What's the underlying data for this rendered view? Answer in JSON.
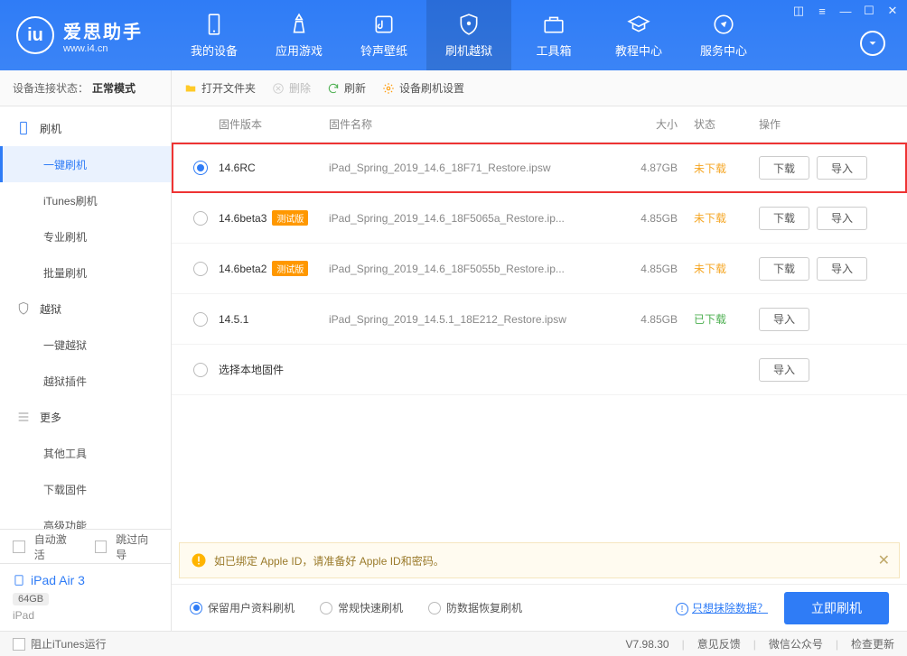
{
  "app": {
    "title": "爱思助手",
    "subtitle": "www.i4.cn"
  },
  "nav": {
    "items": [
      {
        "label": "我的设备"
      },
      {
        "label": "应用游戏"
      },
      {
        "label": "铃声壁纸"
      },
      {
        "label": "刷机越狱"
      },
      {
        "label": "工具箱"
      },
      {
        "label": "教程中心"
      },
      {
        "label": "服务中心"
      }
    ]
  },
  "sidebar": {
    "conn_label": "设备连接状态：",
    "conn_value": "正常模式",
    "groups": [
      {
        "label": "刷机",
        "items": [
          "一键刷机",
          "iTunes刷机",
          "专业刷机",
          "批量刷机"
        ],
        "active": 0
      },
      {
        "label": "越狱",
        "items": [
          "一键越狱",
          "越狱插件"
        ]
      },
      {
        "label": "更多",
        "items": [
          "其他工具",
          "下载固件",
          "高级功能"
        ]
      }
    ],
    "auto_activate": "自动激活",
    "skip_guide": "跳过向导",
    "device": {
      "name": "iPad Air 3",
      "storage": "64GB",
      "type": "iPad"
    }
  },
  "toolbar": {
    "open_folder": "打开文件夹",
    "delete": "删除",
    "refresh": "刷新",
    "settings": "设备刷机设置"
  },
  "table": {
    "headers": {
      "version": "固件版本",
      "name": "固件名称",
      "size": "大小",
      "status": "状态",
      "actions": "操作"
    }
  },
  "firmware": [
    {
      "version": "14.6RC",
      "beta": false,
      "name": "iPad_Spring_2019_14.6_18F71_Restore.ipsw",
      "size": "4.87GB",
      "status": "未下载",
      "status_type": "undownloaded",
      "selected": true,
      "highlighted": true,
      "can_download": true
    },
    {
      "version": "14.6beta3",
      "beta": true,
      "name": "iPad_Spring_2019_14.6_18F5065a_Restore.ip...",
      "size": "4.85GB",
      "status": "未下载",
      "status_type": "undownloaded",
      "selected": false,
      "highlighted": false,
      "can_download": true
    },
    {
      "version": "14.6beta2",
      "beta": true,
      "name": "iPad_Spring_2019_14.6_18F5055b_Restore.ip...",
      "size": "4.85GB",
      "status": "未下载",
      "status_type": "undownloaded",
      "selected": false,
      "highlighted": false,
      "can_download": true
    },
    {
      "version": "14.5.1",
      "beta": false,
      "name": "iPad_Spring_2019_14.5.1_18E212_Restore.ipsw",
      "size": "4.85GB",
      "status": "已下载",
      "status_type": "downloaded",
      "selected": false,
      "highlighted": false,
      "can_download": false
    }
  ],
  "local_firmware_label": "选择本地固件",
  "beta_badge": "测试版",
  "btn": {
    "download": "下载",
    "import": "导入"
  },
  "alert": "如已绑定 Apple ID，请准备好 Apple ID和密码。",
  "options": {
    "opt1": "保留用户资料刷机",
    "opt2": "常规快速刷机",
    "opt3": "防数据恢复刷机",
    "erase_link": "只想抹除数据？",
    "flash_now": "立即刷机"
  },
  "footer": {
    "block_itunes": "阻止iTunes运行",
    "version": "V7.98.30",
    "feedback": "意见反馈",
    "wechat": "微信公众号",
    "update": "检查更新"
  }
}
